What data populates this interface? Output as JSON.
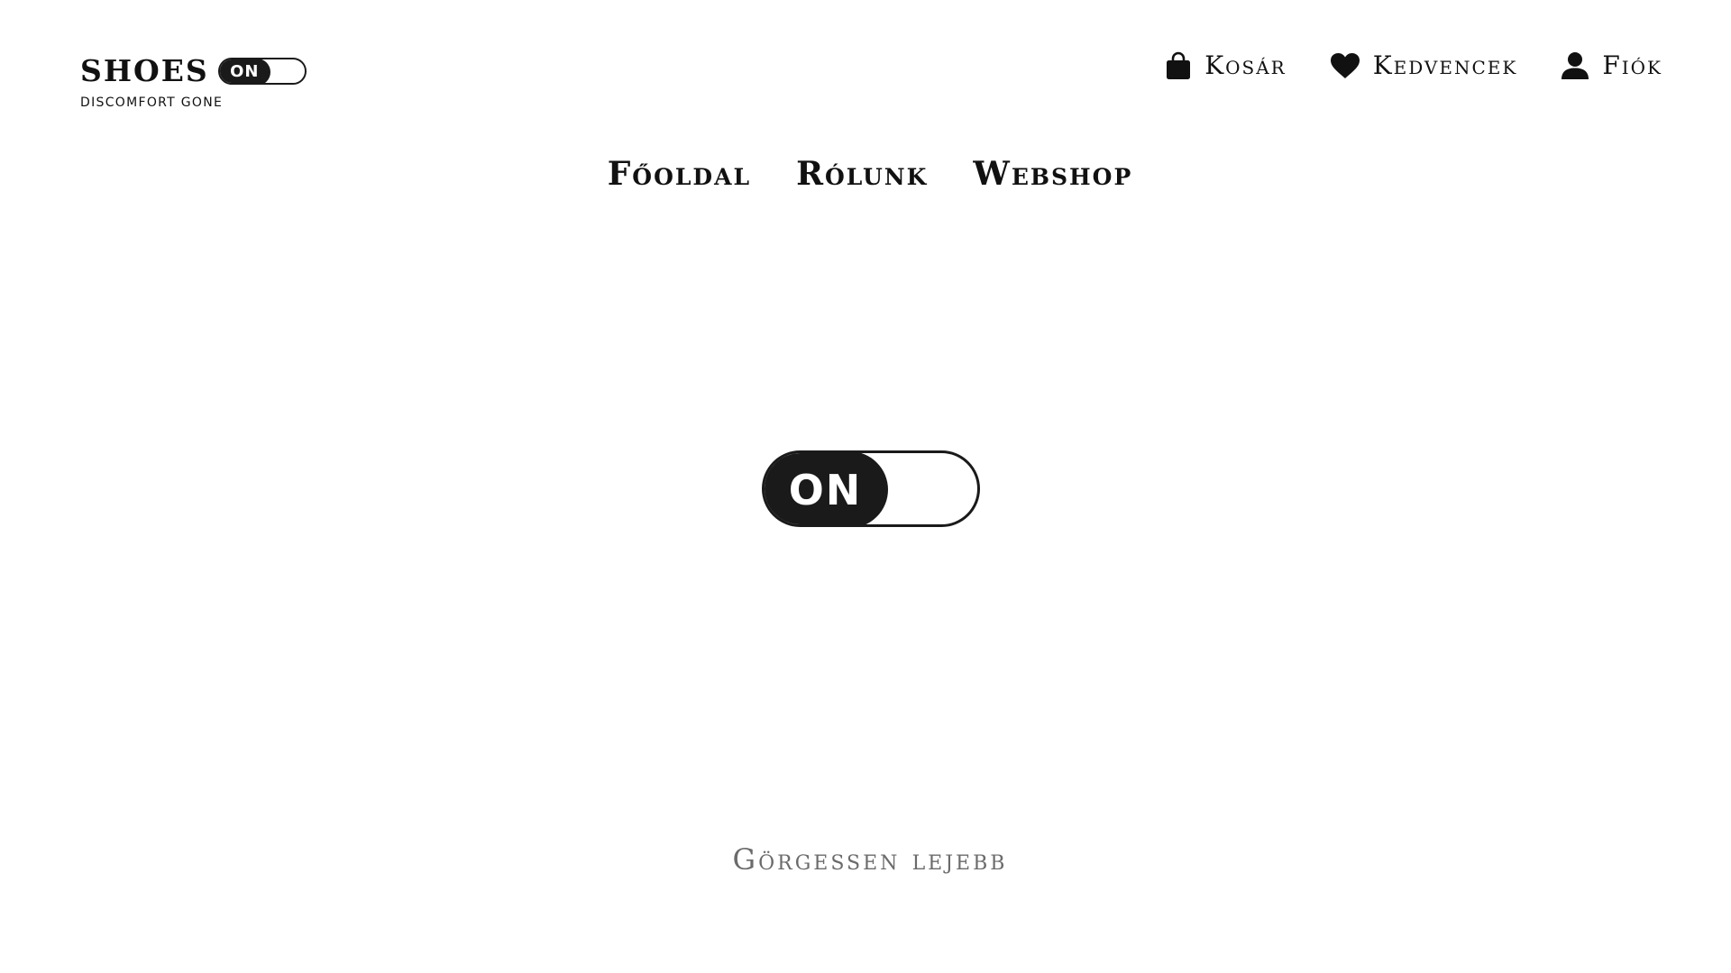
{
  "logo": {
    "word": "SHOES",
    "toggle_label": "ON",
    "tagline": "DISCOMFORT GONE"
  },
  "utility_nav": {
    "cart": {
      "label": "Kosár",
      "icon": "shopping-bag-icon"
    },
    "favorites": {
      "label": "Kedvencek",
      "icon": "heart-icon"
    },
    "account": {
      "label": "Fiók",
      "icon": "user-icon"
    }
  },
  "main_nav": {
    "items": [
      {
        "label": "Főoldal"
      },
      {
        "label": "Rólunk"
      },
      {
        "label": "Webshop"
      }
    ]
  },
  "hero": {
    "toggle_label": "ON"
  },
  "scroll_hint": "Görgessen lejebb",
  "colors": {
    "primary": "#1a1a1a",
    "background": "#ffffff",
    "muted_text": "#6b6b6b"
  }
}
